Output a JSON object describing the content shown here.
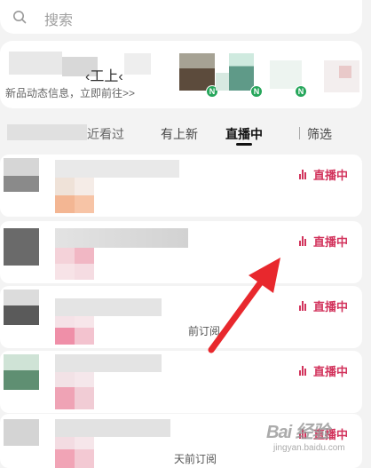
{
  "search": {
    "placeholder": "搜索"
  },
  "promo": {
    "title_fragment": "‹工上‹",
    "subtitle": "新品动态信息，立即前往>>",
    "badge": "N"
  },
  "tabs": [
    {
      "label": "近看过",
      "active": false
    },
    {
      "label": "有上新",
      "active": false
    },
    {
      "label": "直播中",
      "active": true
    },
    {
      "label": "筛选",
      "active": false
    }
  ],
  "list": {
    "live_label": "直播中",
    "items": [
      {
        "tail": ""
      },
      {
        "tail": ""
      },
      {
        "tail": "前订阅"
      },
      {
        "tail": ""
      },
      {
        "tail": "天前订阅"
      }
    ]
  },
  "watermark": {
    "brand": "Bai 经验",
    "url": "jingyan.baidu.com"
  },
  "colors": {
    "live": "#d2335c",
    "badge": "#26a65b",
    "arrow": "#e8282d"
  }
}
